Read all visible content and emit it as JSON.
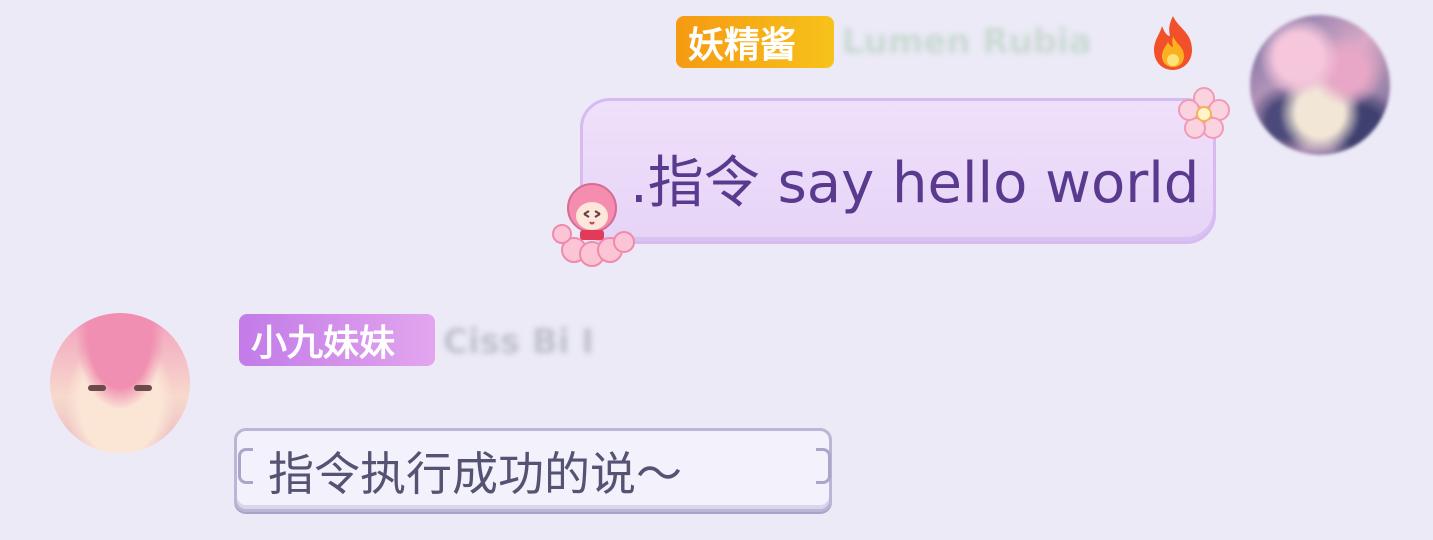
{
  "messages": [
    {
      "side": "right",
      "sender_tag": "妖精酱",
      "sender_name": "Lumen Rubia",
      "text": ".指令 say hello world",
      "tag_color": "#f5a314",
      "badge_icon": "fire-icon"
    },
    {
      "side": "left",
      "sender_tag": "小九妹妹",
      "sender_name": "Ciss Bi I",
      "text": "指令执行成功的说～",
      "tag_color": "#c98be9"
    }
  ],
  "colors": {
    "background": "#eceaf7",
    "my_bubble": "#ebdbfa",
    "my_text": "#5a3a8e",
    "bot_bubble": "#f3f1fb",
    "bot_text": "#555373"
  }
}
